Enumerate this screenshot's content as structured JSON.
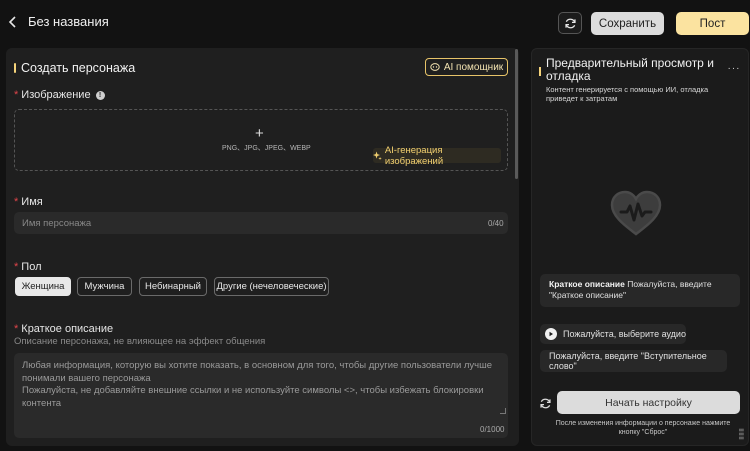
{
  "header": {
    "title": "Без названия",
    "save_label": "Сохранить",
    "post_label": "Пост"
  },
  "form": {
    "section_title": "Создать персонажа",
    "ai_helper_label": "AI помощник",
    "image": {
      "label": "Изображение",
      "plus": "+",
      "formats": "PNG、JPG、JPEG、WEBP",
      "ai_gen_label": "AI-генерация изображений"
    },
    "name": {
      "label": "Имя",
      "placeholder": "Имя персонажа",
      "counter": "0/40"
    },
    "gender": {
      "label": "Пол",
      "options": [
        "Женщина",
        "Мужчина",
        "Небинарный",
        "Другие (нечеловеческие)"
      ],
      "selected": "Женщина"
    },
    "short_desc": {
      "label": "Краткое описание",
      "hint": "Описание персонажа, не влияющее на эффект общения",
      "placeholder_line1": "Любая информация, которую вы хотите показать, в основном для того, чтобы другие пользователи лучше понимали вашего персонажа",
      "placeholder_line2": "Пожалуйста, не добавляйте внешние ссылки и не используйте символы <>, чтобы избежать блокировки контента",
      "counter": "0/1000"
    }
  },
  "preview": {
    "title": "Предварительный просмотр и отладка",
    "more": "···",
    "subtitle": "Контент генерируется с помощью ИИ, отладка приведет к затратам",
    "desc_card_bold": "Краткое описание",
    "desc_card_text": " Пожалуйста, введите \"Краткое описание\"",
    "audio_label": "Пожалуйста, выберите аудио",
    "intro_label": "Пожалуйста, введите \"Вступительное слово\"",
    "start_label": "Начать настройку",
    "reset_hint": "После изменения информации о персонаже нажмите кнопку \"Сброс\""
  },
  "colors": {
    "accent": "#f5d37a",
    "post_bg": "#fbe3a0",
    "required": "#e0454a",
    "panel_bg": "#1f1f1f"
  },
  "icons": [
    "back-chevron-icon",
    "refresh-icon",
    "ai-helper-icon",
    "info-icon",
    "sparkle-icon",
    "heart-wave-icon",
    "play-icon",
    "reset-icon"
  ]
}
